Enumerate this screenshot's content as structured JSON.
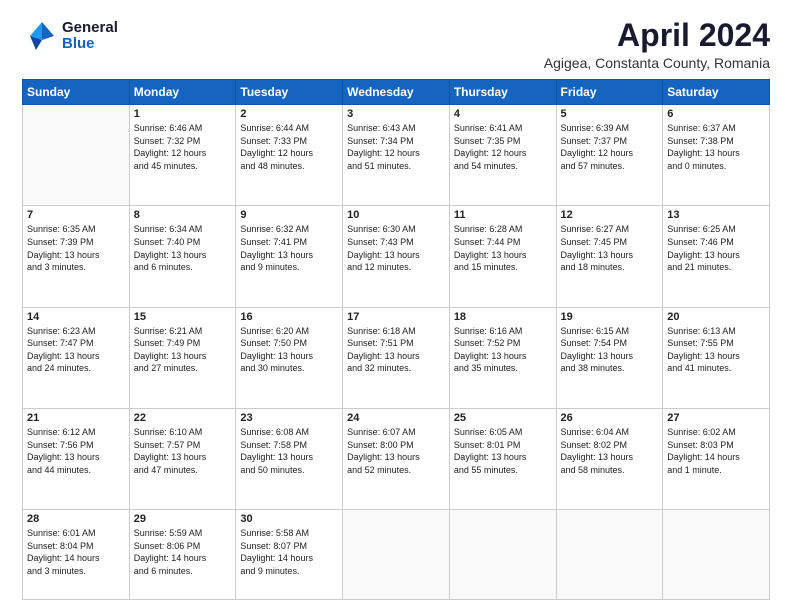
{
  "header": {
    "logo_general": "General",
    "logo_blue": "Blue",
    "month": "April 2024",
    "location": "Agigea, Constanta County, Romania"
  },
  "weekdays": [
    "Sunday",
    "Monday",
    "Tuesday",
    "Wednesday",
    "Thursday",
    "Friday",
    "Saturday"
  ],
  "weeks": [
    [
      {
        "day": "",
        "info": ""
      },
      {
        "day": "1",
        "info": "Sunrise: 6:46 AM\nSunset: 7:32 PM\nDaylight: 12 hours\nand 45 minutes."
      },
      {
        "day": "2",
        "info": "Sunrise: 6:44 AM\nSunset: 7:33 PM\nDaylight: 12 hours\nand 48 minutes."
      },
      {
        "day": "3",
        "info": "Sunrise: 6:43 AM\nSunset: 7:34 PM\nDaylight: 12 hours\nand 51 minutes."
      },
      {
        "day": "4",
        "info": "Sunrise: 6:41 AM\nSunset: 7:35 PM\nDaylight: 12 hours\nand 54 minutes."
      },
      {
        "day": "5",
        "info": "Sunrise: 6:39 AM\nSunset: 7:37 PM\nDaylight: 12 hours\nand 57 minutes."
      },
      {
        "day": "6",
        "info": "Sunrise: 6:37 AM\nSunset: 7:38 PM\nDaylight: 13 hours\nand 0 minutes."
      }
    ],
    [
      {
        "day": "7",
        "info": "Sunrise: 6:35 AM\nSunset: 7:39 PM\nDaylight: 13 hours\nand 3 minutes."
      },
      {
        "day": "8",
        "info": "Sunrise: 6:34 AM\nSunset: 7:40 PM\nDaylight: 13 hours\nand 6 minutes."
      },
      {
        "day": "9",
        "info": "Sunrise: 6:32 AM\nSunset: 7:41 PM\nDaylight: 13 hours\nand 9 minutes."
      },
      {
        "day": "10",
        "info": "Sunrise: 6:30 AM\nSunset: 7:43 PM\nDaylight: 13 hours\nand 12 minutes."
      },
      {
        "day": "11",
        "info": "Sunrise: 6:28 AM\nSunset: 7:44 PM\nDaylight: 13 hours\nand 15 minutes."
      },
      {
        "day": "12",
        "info": "Sunrise: 6:27 AM\nSunset: 7:45 PM\nDaylight: 13 hours\nand 18 minutes."
      },
      {
        "day": "13",
        "info": "Sunrise: 6:25 AM\nSunset: 7:46 PM\nDaylight: 13 hours\nand 21 minutes."
      }
    ],
    [
      {
        "day": "14",
        "info": "Sunrise: 6:23 AM\nSunset: 7:47 PM\nDaylight: 13 hours\nand 24 minutes."
      },
      {
        "day": "15",
        "info": "Sunrise: 6:21 AM\nSunset: 7:49 PM\nDaylight: 13 hours\nand 27 minutes."
      },
      {
        "day": "16",
        "info": "Sunrise: 6:20 AM\nSunset: 7:50 PM\nDaylight: 13 hours\nand 30 minutes."
      },
      {
        "day": "17",
        "info": "Sunrise: 6:18 AM\nSunset: 7:51 PM\nDaylight: 13 hours\nand 32 minutes."
      },
      {
        "day": "18",
        "info": "Sunrise: 6:16 AM\nSunset: 7:52 PM\nDaylight: 13 hours\nand 35 minutes."
      },
      {
        "day": "19",
        "info": "Sunrise: 6:15 AM\nSunset: 7:54 PM\nDaylight: 13 hours\nand 38 minutes."
      },
      {
        "day": "20",
        "info": "Sunrise: 6:13 AM\nSunset: 7:55 PM\nDaylight: 13 hours\nand 41 minutes."
      }
    ],
    [
      {
        "day": "21",
        "info": "Sunrise: 6:12 AM\nSunset: 7:56 PM\nDaylight: 13 hours\nand 44 minutes."
      },
      {
        "day": "22",
        "info": "Sunrise: 6:10 AM\nSunset: 7:57 PM\nDaylight: 13 hours\nand 47 minutes."
      },
      {
        "day": "23",
        "info": "Sunrise: 6:08 AM\nSunset: 7:58 PM\nDaylight: 13 hours\nand 50 minutes."
      },
      {
        "day": "24",
        "info": "Sunrise: 6:07 AM\nSunset: 8:00 PM\nDaylight: 13 hours\nand 52 minutes."
      },
      {
        "day": "25",
        "info": "Sunrise: 6:05 AM\nSunset: 8:01 PM\nDaylight: 13 hours\nand 55 minutes."
      },
      {
        "day": "26",
        "info": "Sunrise: 6:04 AM\nSunset: 8:02 PM\nDaylight: 13 hours\nand 58 minutes."
      },
      {
        "day": "27",
        "info": "Sunrise: 6:02 AM\nSunset: 8:03 PM\nDaylight: 14 hours\nand 1 minute."
      }
    ],
    [
      {
        "day": "28",
        "info": "Sunrise: 6:01 AM\nSunset: 8:04 PM\nDaylight: 14 hours\nand 3 minutes."
      },
      {
        "day": "29",
        "info": "Sunrise: 5:59 AM\nSunset: 8:06 PM\nDaylight: 14 hours\nand 6 minutes."
      },
      {
        "day": "30",
        "info": "Sunrise: 5:58 AM\nSunset: 8:07 PM\nDaylight: 14 hours\nand 9 minutes."
      },
      {
        "day": "",
        "info": ""
      },
      {
        "day": "",
        "info": ""
      },
      {
        "day": "",
        "info": ""
      },
      {
        "day": "",
        "info": ""
      }
    ]
  ]
}
